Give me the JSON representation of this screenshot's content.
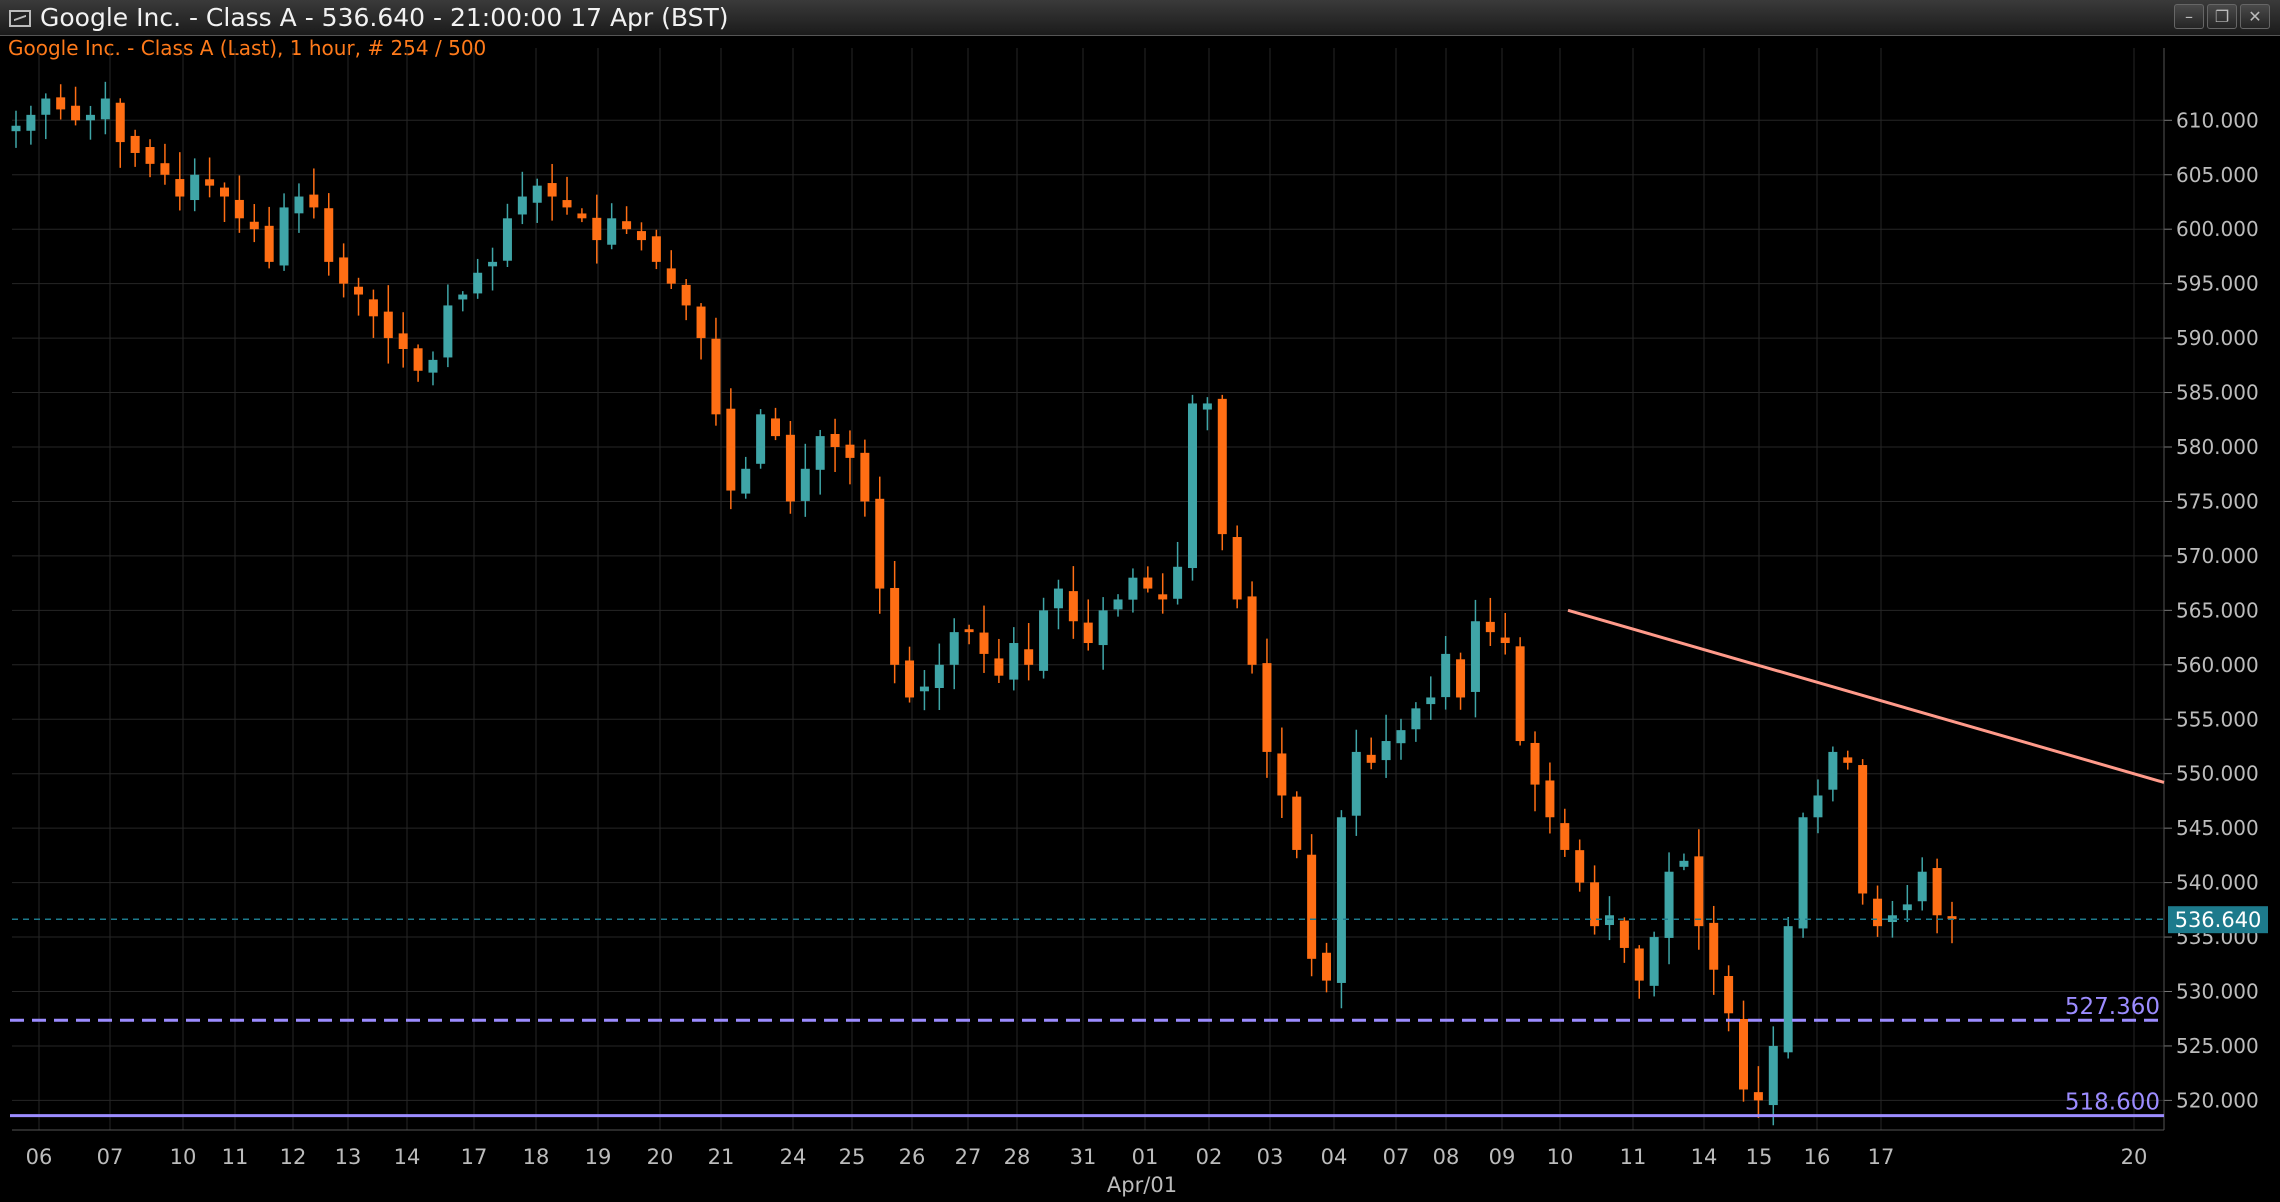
{
  "window": {
    "title": "Google Inc. - Class A - 536.640 - 21:00:00  17 Apr (BST)",
    "subtitle": "Google Inc. - Class A (Last), 1 hour, # 254 / 500",
    "icon": "chart-window-icon",
    "buttons": [
      "minimize",
      "restore",
      "close"
    ]
  },
  "colors": {
    "background": "#000000",
    "up_candle": "#3fa5a7",
    "down_candle": "#ff6e14",
    "trendline": "#ff9a8a",
    "support": "#9c8cff",
    "last_price": "#1d7a8c",
    "grid": "#262626"
  },
  "chart_data": {
    "type": "candlestick",
    "interval": "1 hour",
    "last_price": "536.640",
    "ylim": [
      516,
      612
    ],
    "y_ticks": [
      "610.000",
      "605.000",
      "600.000",
      "595.000",
      "590.000",
      "585.000",
      "580.000",
      "575.000",
      "570.000",
      "565.000",
      "560.000",
      "555.000",
      "550.000",
      "545.000",
      "540.000",
      "535.000",
      "530.000",
      "525.000",
      "520.000"
    ],
    "x_ticks": [
      "06",
      "07",
      "10",
      "11",
      "12",
      "13",
      "14",
      "17",
      "18",
      "19",
      "20",
      "21",
      "24",
      "25",
      "26",
      "27",
      "28",
      "31",
      "01",
      "02",
      "03",
      "04",
      "07",
      "08",
      "09",
      "10",
      "11",
      "14",
      "15",
      "16",
      "17",
      "20"
    ],
    "x_sublabel": "Apr/01",
    "closes": [
      609.5,
      610.5,
      612,
      611,
      610,
      610.5,
      612,
      608,
      607,
      606,
      605,
      603,
      605,
      604,
      603,
      601,
      600,
      597,
      602,
      603,
      602,
      597,
      595,
      594,
      592,
      590,
      589,
      587,
      588,
      593,
      594,
      596,
      597,
      601,
      603,
      604,
      603,
      602,
      601,
      599,
      601,
      600,
      599,
      597,
      595,
      593,
      590,
      583,
      576,
      578,
      583,
      581,
      575,
      578,
      581,
      580,
      579,
      575,
      567,
      560,
      557,
      558,
      560,
      563,
      563,
      561,
      559,
      562,
      560,
      565,
      567,
      564,
      562,
      565,
      566,
      568,
      567,
      566,
      569,
      584,
      584,
      572,
      566,
      560,
      552,
      548,
      543,
      533,
      531,
      546,
      552,
      551,
      553,
      554,
      556,
      557,
      561,
      557,
      564,
      563,
      562,
      553,
      549,
      546,
      543,
      540,
      536,
      537,
      534,
      531,
      535,
      541,
      542,
      536,
      532,
      528,
      521,
      520,
      525,
      536,
      546,
      548,
      552,
      551,
      539,
      536,
      537,
      538,
      541,
      537,
      536.64
    ],
    "trendline": {
      "from": [
        "10",
        565
      ],
      "to": [
        "20",
        549.2
      ]
    },
    "support_lines": [
      {
        "label": "527.360",
        "value": 527.36,
        "style": "dashed"
      },
      {
        "label": "518.600",
        "value": 518.6,
        "style": "solid"
      }
    ]
  }
}
